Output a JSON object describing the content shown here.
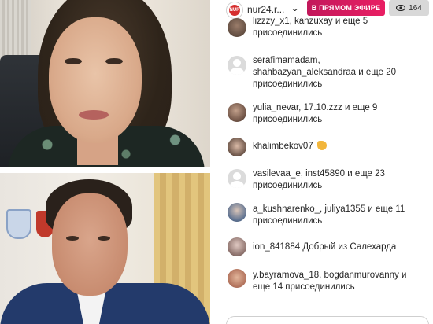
{
  "header": {
    "handle": "nur24.r...",
    "live_label": "В ПРЯМОМ ЭФИРЕ",
    "viewers": "164",
    "brand_logo_text": "NUR"
  },
  "comments": [
    {
      "user": "lizzzy_x1, kanzuxay",
      "text": " и еще 5",
      "cont": "присоединились",
      "avatar": "photo"
    },
    {
      "user": "serafimamadam,",
      "text": "",
      "cont": "shahbazyan_aleksandraa и еще 20",
      "cont2": "присоединились",
      "avatar": "blank"
    },
    {
      "user": "yulia_nevar, 17.10.zzz",
      "text": " и еще 9",
      "cont": "присоединились",
      "avatar": "photo"
    },
    {
      "user": "khalimbekov07",
      "text": "",
      "emoji": true,
      "avatar": "photo"
    },
    {
      "user": "vasilevaa_e, inst45890",
      "text": " и еще 23",
      "cont": "присоединились",
      "avatar": "blank"
    },
    {
      "user": "a_kushnarenko_, juliya1355",
      "text": " и еще 11",
      "cont": "присоединились",
      "avatar": "photo"
    },
    {
      "user": "ion_841884",
      "text": " Добрый из Салехарда",
      "avatar": "photo"
    },
    {
      "user": "y.bayramova_18, bogdanmurovanny",
      "text": " и",
      "cont": "еще 14 присоединились",
      "avatar": "photo"
    }
  ],
  "colors": {
    "live_badge": "#e91e63",
    "viewer_badge": "#d8d8d8"
  }
}
